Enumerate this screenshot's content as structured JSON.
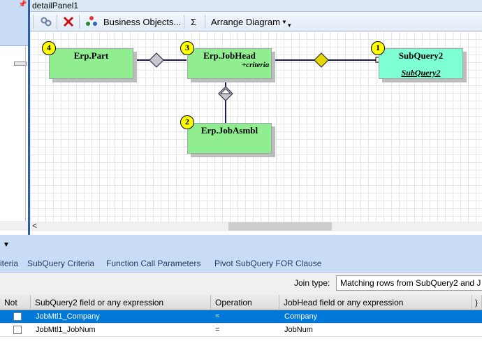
{
  "panel": {
    "title": "detailPanel1"
  },
  "toolbar": {
    "business_objects_label": "Business Objects...",
    "sigma_label": "Σ",
    "arrange_label": "Arrange Diagram"
  },
  "diagram": {
    "nodes": [
      {
        "badge": "4",
        "title": "Erp.Part"
      },
      {
        "badge": "3",
        "title": "Erp.JobHead",
        "subtitle": "+criteria"
      },
      {
        "badge": "1",
        "title": "SubQuery2",
        "subtitle": "SubQuery2"
      },
      {
        "badge": "2",
        "title": "Erp.JobAsmbl"
      }
    ]
  },
  "tabs": [
    {
      "label": "iteria"
    },
    {
      "label": "SubQuery Criteria"
    },
    {
      "label": "Function Call Parameters"
    },
    {
      "label": "Pivot SubQuery FOR Clause"
    }
  ],
  "join": {
    "label": "Join type:",
    "value": "Matching rows from SubQuery2 and J"
  },
  "grid": {
    "headers": {
      "not": "Not",
      "left_field": "SubQuery2 field or any expression",
      "operation": "Operation",
      "right_field": "JobHead field or any expression",
      "extra": ")"
    },
    "rows": [
      {
        "left": "JobMtl1_Company",
        "op": "=",
        "right": "Company",
        "selected": true
      },
      {
        "left": "JobMtl1_JobNum",
        "op": "=",
        "right": "JobNum",
        "selected": false
      }
    ]
  },
  "colors": {
    "node_green": "#90ee90",
    "node_cyan": "#7fffd4",
    "badge": "#ffff00",
    "selection": "#0078d7"
  }
}
